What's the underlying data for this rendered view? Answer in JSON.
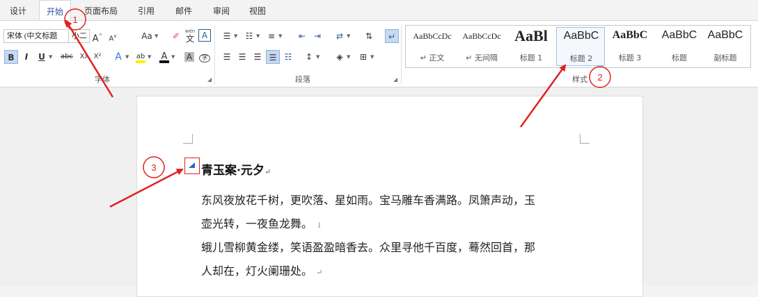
{
  "tabs": [
    "设计",
    "开始",
    "页面布局",
    "引用",
    "邮件",
    "审阅",
    "视图"
  ],
  "active_tab": "开始",
  "font": {
    "family": "宋体 (中文标题",
    "size": "小二",
    "grow_label": "A",
    "shrink_label": "A",
    "case_label": "Aa",
    "bold": "B",
    "italic": "I",
    "underline": "U",
    "strike": "abc",
    "subscript": "X₂",
    "superscript": "X²",
    "effects": "A",
    "highlight": "ab",
    "color": "A",
    "shading": "A",
    "encircle": "字",
    "phonetic_label": "wén",
    "phonetic_char": "文",
    "group_label": "字体"
  },
  "paragraph": {
    "group_label": "段落"
  },
  "styles": {
    "group_label": "样式",
    "items": [
      {
        "sample": "AaBbCcDc",
        "name": "↵ 正文"
      },
      {
        "sample": "AaBbCcDc",
        "name": "↵ 无间隔"
      },
      {
        "sample": "AaBl",
        "name": "标题 1"
      },
      {
        "sample": "AaBbC",
        "name": "标题 2"
      },
      {
        "sample": "AaBbC",
        "name": "标题 3"
      },
      {
        "sample": "AaBbC",
        "name": "标题"
      },
      {
        "sample": "AaBbC",
        "name": "副标题"
      }
    ],
    "selected_index": 3
  },
  "document": {
    "heading": "青玉案·元夕",
    "heading_mark": "↵",
    "lines": [
      "东风夜放花千树，更吹落、星如雨。宝马雕车香满路。凤箫声动，玉",
      "壶光转，一夜鱼龙舞。",
      "蛾儿雪柳黄金缕，笑语盈盈暗香去。众里寻他千百度，蓦然回首，那",
      "人却在，灯火阑珊处。"
    ],
    "line_marks": [
      "",
      "↓",
      "",
      "↵"
    ]
  },
  "callouts": [
    "1",
    "2",
    "3"
  ],
  "colors": {
    "accent": "#2b579a",
    "annotation": "#e02020",
    "selected_style_border": "#9bc0e8"
  }
}
